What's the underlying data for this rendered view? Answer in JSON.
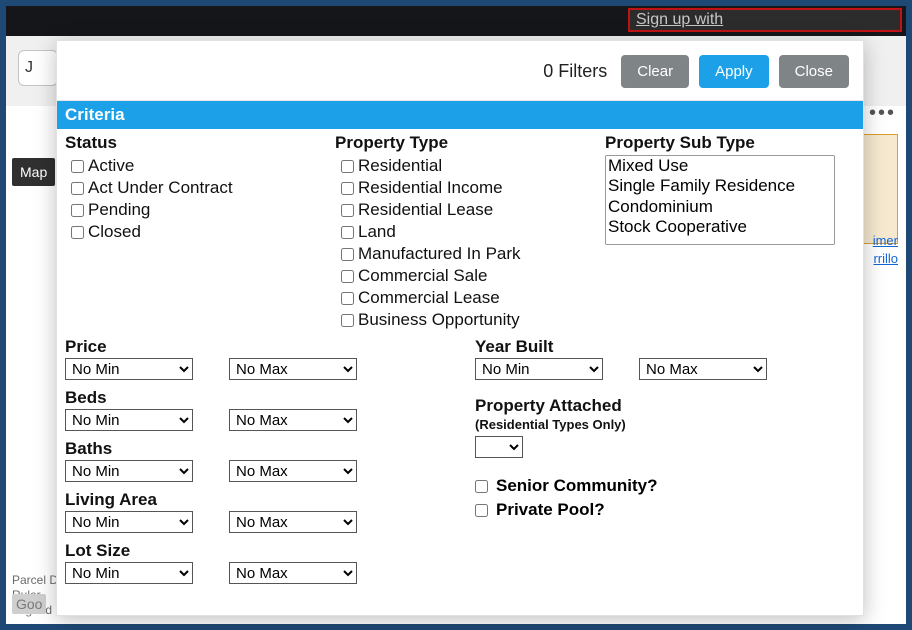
{
  "signup_prefix": "Sign up with",
  "bg": {
    "url_stub": "J",
    "map_label": "Map",
    "right_links": [
      "imer",
      "rrillo"
    ],
    "bottom_lines": [
      "Parcel D",
      "Ruler",
      "Legend"
    ],
    "goo": "Goo"
  },
  "modal": {
    "filter_count_text": "0 Filters",
    "buttons": {
      "clear": "Clear",
      "apply": "Apply",
      "close": "Close"
    },
    "criteria_label": "Criteria"
  },
  "status": {
    "label": "Status",
    "options": [
      "Active",
      "Act Under Contract",
      "Pending",
      "Closed"
    ]
  },
  "ptype": {
    "label": "Property Type",
    "options": [
      "Residential",
      "Residential Income",
      "Residential Lease",
      "Land",
      "Manufactured In Park",
      "Commercial Sale",
      "Commercial Lease",
      "Business Opportunity"
    ]
  },
  "subtype": {
    "label": "Property Sub Type",
    "options": [
      "Mixed Use",
      "Single Family Residence",
      "Condominium",
      "Stock Cooperative"
    ]
  },
  "ranges": {
    "price": {
      "label": "Price",
      "min": "No Min",
      "max": "No Max"
    },
    "beds": {
      "label": "Beds",
      "min": "No Min",
      "max": "No Max"
    },
    "baths": {
      "label": "Baths",
      "min": "No Min",
      "max": "No Max"
    },
    "living_area": {
      "label": "Living Area",
      "min": "No Min",
      "max": "No Max"
    },
    "lot_size": {
      "label": "Lot Size",
      "min": "No Min",
      "max": "No Max"
    },
    "year_built": {
      "label": "Year Built",
      "min": "No Min",
      "max": "No Max"
    }
  },
  "attached": {
    "label": "Property Attached",
    "note": "(Residential Types Only)",
    "selected": ""
  },
  "bools": {
    "senior": "Senior Community?",
    "pool": "Private Pool?"
  }
}
